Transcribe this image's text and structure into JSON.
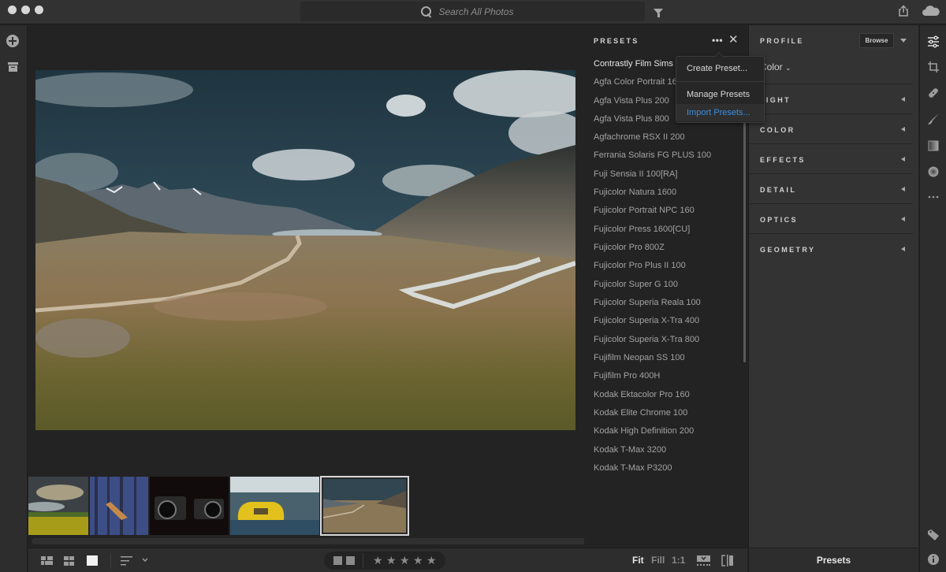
{
  "titlebar": {
    "search_placeholder": "Search All Photos",
    "icons": [
      "window-close-dot",
      "window-minimize-dot",
      "window-zoom-dot",
      "search-icon",
      "filter-icon",
      "share-icon",
      "cloud-icon"
    ]
  },
  "left_rail": {
    "icons": [
      "add-photos-icon",
      "archive-icon"
    ]
  },
  "presets_panel": {
    "title": "PRESETS",
    "more_label": "•••",
    "close_label": "✕",
    "items": [
      "Contrastly Film Sims",
      "Agfa Color Portrait 160",
      "Agfa Vista Plus 200",
      "Agfa Vista Plus 800",
      "Agfachrome RSX II 200",
      "Ferrania Solaris FG PLUS 100",
      "Fuji Sensia II 100[RA]",
      "Fujicolor Natura 1600",
      "Fujicolor Portrait NPC 160",
      "Fujicolor Press 1600[CU]",
      "Fujicolor Pro 800Z",
      "Fujicolor Pro Plus II 100",
      "Fujicolor Super G 100",
      "Fujicolor Superia Reala 100",
      "Fujicolor Superia X-Tra 400",
      "Fujicolor Superia X-Tra 800",
      "Fujifilm Neopan SS 100",
      "Fujifilm Pro 400H",
      "Kodak Ektacolor Pro 160",
      "Kodak Elite Chrome 100",
      "Kodak High Definition 200",
      "Kodak T-Max 3200",
      "Kodak T-Max P3200"
    ]
  },
  "presets_menu": {
    "items": [
      "Create Preset...",
      "Manage Presets",
      "Import Presets..."
    ],
    "highlighted_index": 2,
    "highlight_color": "#3b8ee0"
  },
  "edit_panel": {
    "profile_title": "PROFILE",
    "browse_label": "Browse",
    "profile_value": "Color",
    "sections": [
      "LIGHT",
      "COLOR",
      "EFFECTS",
      "DETAIL",
      "OPTICS",
      "GEOMETRY"
    ]
  },
  "tool_rail": {
    "icons": [
      "edit-sliders-icon",
      "crop-rotate-icon",
      "healing-brush-icon",
      "brush-icon",
      "linear-gradient-icon",
      "radial-gradient-icon",
      "more-icon",
      "tag-icon",
      "info-icon"
    ]
  },
  "filmstrip": {
    "thumbnails": [
      {
        "subject": "Stormy sky over yellow field",
        "selected": false
      },
      {
        "subject": "Misty blue forest",
        "selected": false
      },
      {
        "subject": "Two cameras on black",
        "selected": false
      },
      {
        "subject": "Yellow car in garage",
        "selected": false
      },
      {
        "subject": "Mountain valley landscape",
        "selected": true
      }
    ]
  },
  "main_photo": {
    "subject": "Mountain valley with road and river under dramatic sky"
  },
  "bottom_bar": {
    "view_icons": [
      "photo-grid-icon",
      "square-grid-icon",
      "detail-view-icon",
      "sort-icon"
    ],
    "flag_icons": [
      "flag-pick-icon",
      "flag-reject-icon"
    ],
    "rating_stars": 5,
    "rating_value": 0,
    "star_glyph": "★",
    "zoom_options": [
      "Fit",
      "Fill",
      "1:1"
    ],
    "active_zoom": "Fit",
    "right_icons": [
      "filmstrip-toggle-icon",
      "compare-icon"
    ]
  },
  "presets_footer": {
    "label": "Presets"
  }
}
